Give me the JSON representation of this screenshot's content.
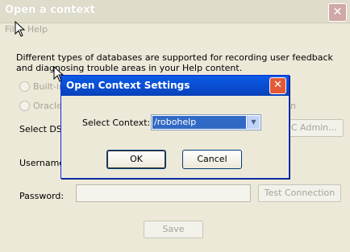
{
  "window": {
    "title": "Open a context",
    "close_label": "✕"
  },
  "menu": [
    "File",
    "Help"
  ],
  "info_text": "Different types of databases are supported for recording user feedback and diagnosing trouble areas in your Help content.",
  "options": [
    "Built-in",
    "Oracle"
  ],
  "dsn_label": "Select DSN",
  "odbc_admin_button": "...C Admin...",
  "odbc_suffix": "n",
  "username_label": "Username:",
  "password_label": "Password:",
  "test_connection_button": "Test Connection",
  "save_button": "Save",
  "modal": {
    "title": "Open Context Settings",
    "close_label": "✕",
    "select_label": "Select Context:",
    "select_value": "/robohelp",
    "ok_button": "OK",
    "cancel_button": "Cancel"
  }
}
